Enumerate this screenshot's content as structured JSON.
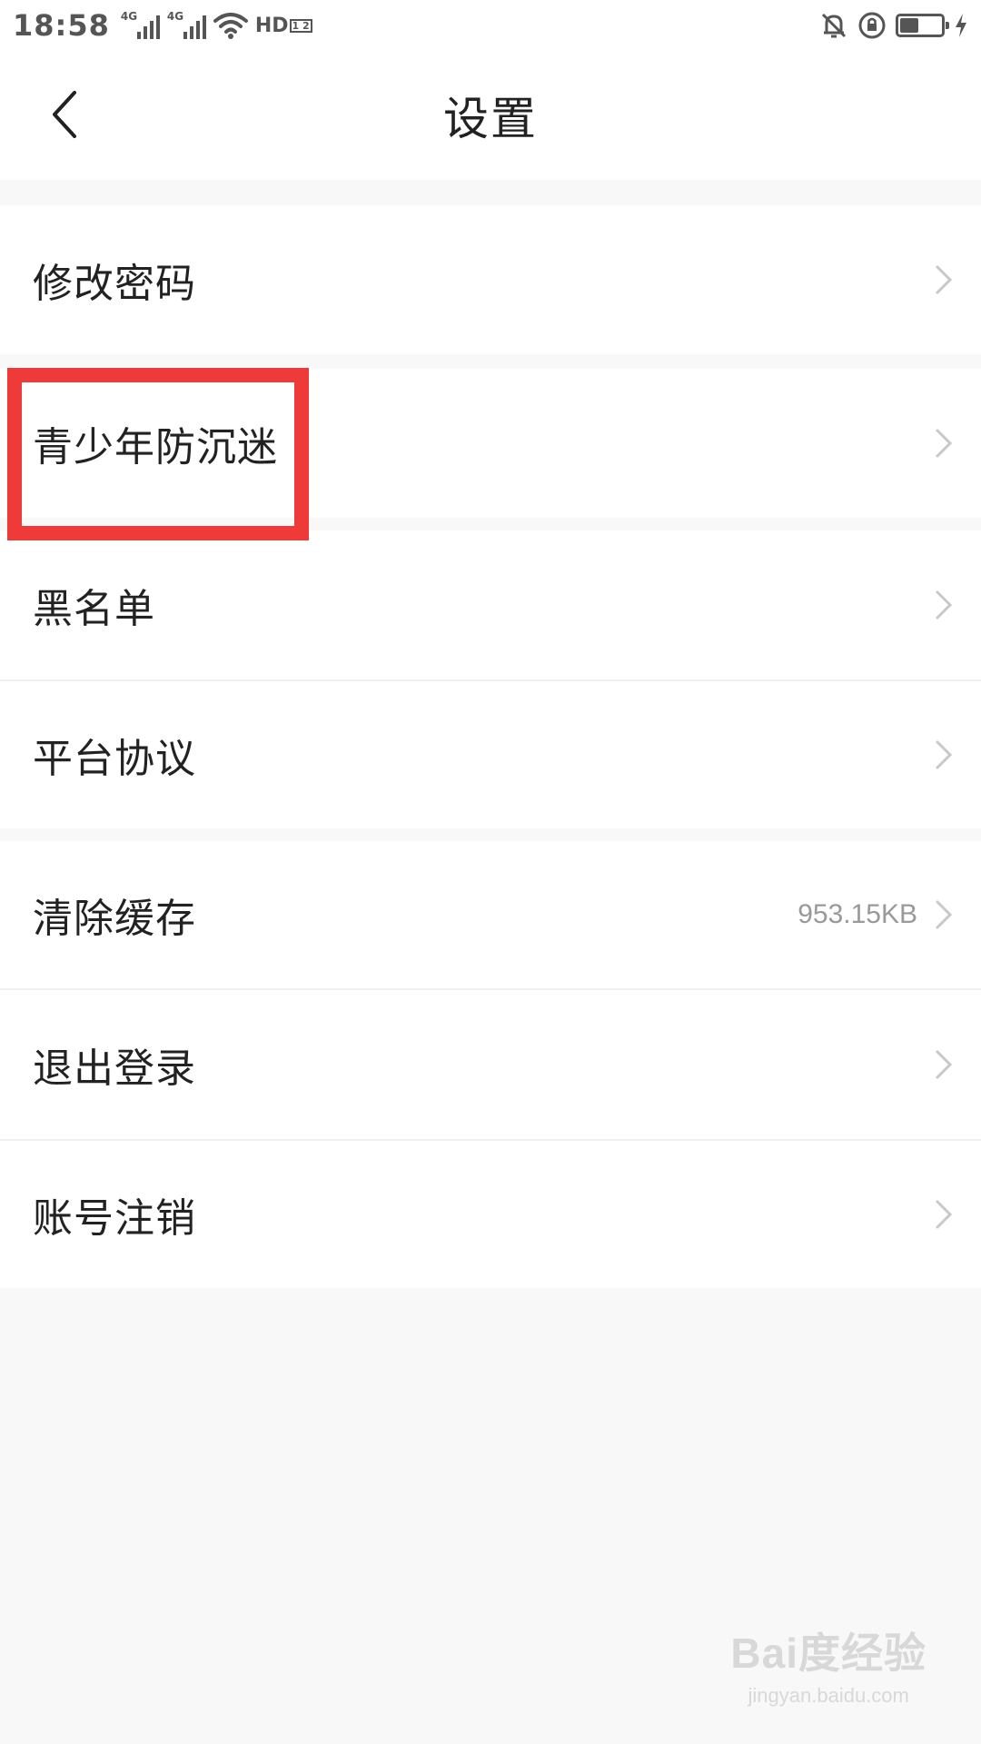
{
  "status_bar": {
    "time": "18:58",
    "signal1_label": "4G",
    "signal2_label": "4G",
    "hd_label": "HD",
    "hd_sub": "1 2",
    "battery_level_pct": 45
  },
  "header": {
    "title": "设置",
    "back_icon": "chevron-left-icon"
  },
  "settings": {
    "items": [
      {
        "label": "修改密码",
        "value": ""
      },
      {
        "label": "青少年防沉迷",
        "value": ""
      },
      {
        "label": "黑名单",
        "value": ""
      },
      {
        "label": "平台协议",
        "value": ""
      },
      {
        "label": "清除缓存",
        "value": "953.15KB"
      },
      {
        "label": "退出登录",
        "value": ""
      },
      {
        "label": "账号注销",
        "value": ""
      }
    ]
  },
  "annotation": {
    "highlight_color": "#ef3a3a"
  },
  "watermark": {
    "logo": "Bai度经验",
    "url": "jingyan.baidu.com"
  },
  "colors": {
    "background": "#f8f8f8",
    "row_background": "#ffffff",
    "text_primary": "#222222",
    "text_secondary": "#999999",
    "chevron": "#c8c8c8"
  }
}
